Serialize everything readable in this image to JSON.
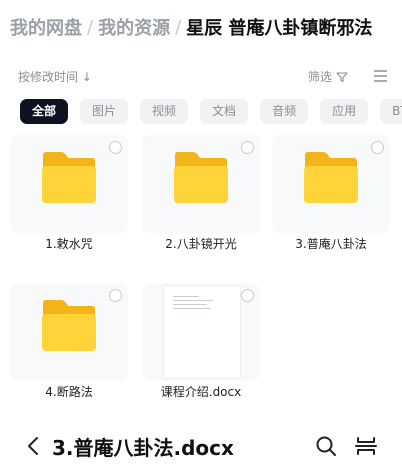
{
  "breadcrumb": {
    "items": [
      "我的网盘",
      "我的资源"
    ],
    "separator": "/",
    "current": "星辰 普庵八卦镇断邪法"
  },
  "sort": {
    "label": "按修改时间",
    "arrow": "↓"
  },
  "filter": {
    "label": "筛选"
  },
  "categories": [
    {
      "label": "全部",
      "active": true
    },
    {
      "label": "图片"
    },
    {
      "label": "视频"
    },
    {
      "label": "文档"
    },
    {
      "label": "音频"
    },
    {
      "label": "应用"
    },
    {
      "label": "BT种子"
    }
  ],
  "files": [
    {
      "name": "1.敕水咒",
      "type": "folder"
    },
    {
      "name": "2.八卦镜开光",
      "type": "folder"
    },
    {
      "name": "3.普庵八卦法",
      "type": "folder"
    },
    {
      "name": "4.断路法",
      "type": "folder"
    },
    {
      "name": "课程介绍.docx",
      "type": "docx"
    }
  ],
  "bottom_bar": {
    "title": "3.普庵八卦法.docx"
  },
  "colors": {
    "folder_back": "#f2b418",
    "folder_front": "#ffd43a",
    "active_chip": "#0c1222",
    "chip_bg": "#f1f2f4",
    "muted_text": "#8a8f96"
  },
  "icons": {
    "back": "chevron-left-icon",
    "search": "search-icon",
    "menu": "split-view-icon",
    "filter": "filter-icon",
    "view": "list-view-icon",
    "folder": "folder-icon"
  }
}
